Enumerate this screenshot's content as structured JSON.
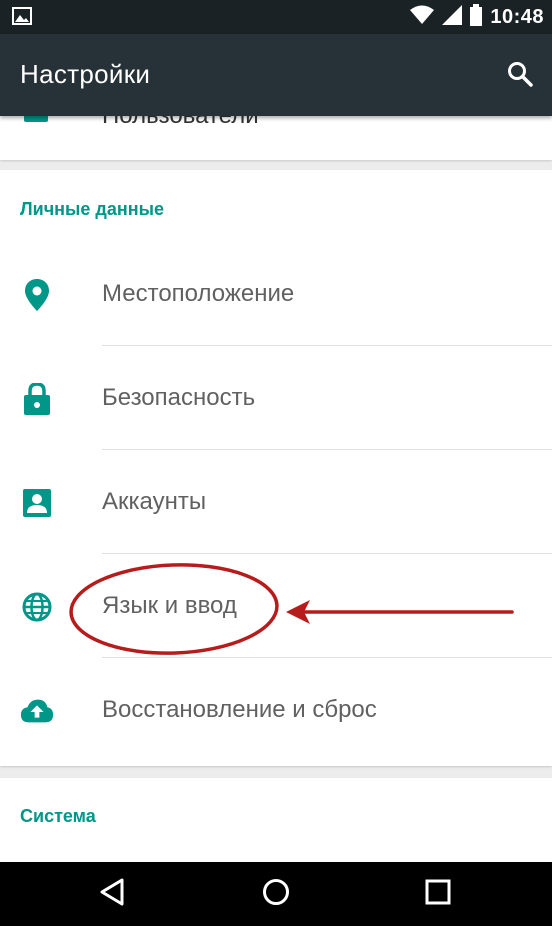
{
  "status_bar": {
    "time": "10:48",
    "icons": [
      "image-notification-icon",
      "wifi-icon",
      "signal-icon",
      "battery-icon"
    ]
  },
  "toolbar": {
    "title": "Настройки",
    "search_icon": "search-icon"
  },
  "top_card": {
    "cut_label": "Пользователи"
  },
  "personal_section": {
    "header": "Личные данные",
    "items": [
      {
        "label": "Местоположение",
        "icon": "location-pin-icon"
      },
      {
        "label": "Безопасность",
        "icon": "lock-icon"
      },
      {
        "label": "Аккаунты",
        "icon": "account-box-icon"
      },
      {
        "label": "Язык и ввод",
        "icon": "globe-icon"
      },
      {
        "label": "Восстановление и сброс",
        "icon": "cloud-upload-icon"
      }
    ]
  },
  "system_section": {
    "header": "Система"
  },
  "nav_bar": {
    "icons": [
      "back-icon",
      "home-icon",
      "recents-icon"
    ]
  },
  "colors": {
    "accent": "#009688",
    "toolbar": "#263238",
    "status_bar": "#1a2226",
    "annotation": "#b71c1c"
  }
}
